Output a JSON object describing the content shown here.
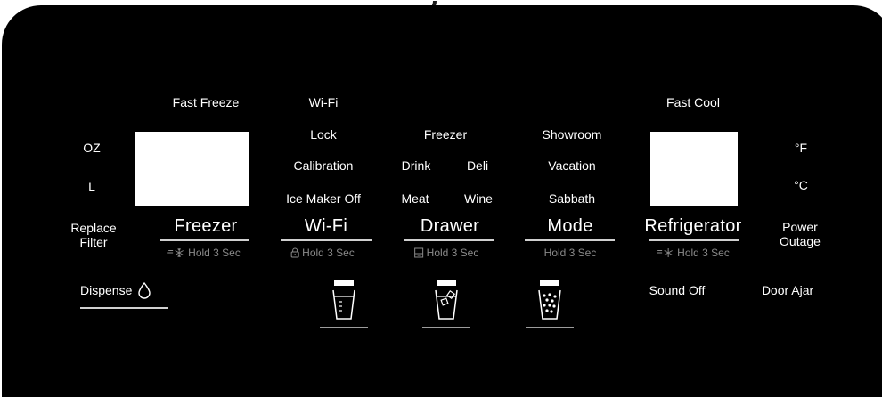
{
  "indicators": {
    "fast_freeze": "Fast Freeze",
    "wifi": "Wi-Fi",
    "lock": "Lock",
    "calibration": "Calibration",
    "ice_maker_off": "Ice Maker Off",
    "freezer": "Freezer",
    "drink": "Drink",
    "deli": "Deli",
    "meat": "Meat",
    "wine": "Wine",
    "showroom": "Showroom",
    "vacation": "Vacation",
    "sabbath": "Sabbath",
    "fast_cool": "Fast Cool",
    "oz": "OZ",
    "l": "L",
    "replace_filter_1": "Replace",
    "replace_filter_2": "Filter",
    "fahrenheit": "°F",
    "celsius": "°C",
    "power_outage_1": "Power",
    "power_outage_2": "Outage",
    "sound_off": "Sound Off",
    "door_ajar": "Door Ajar"
  },
  "buttons": {
    "freezer": {
      "label": "Freezer",
      "hold": "Hold 3 Sec",
      "icon": "fast-freeze-icon"
    },
    "wifi": {
      "label": "Wi-Fi",
      "hold": "Hold 3 Sec",
      "icon": "lock-icon"
    },
    "drawer": {
      "label": "Drawer",
      "hold": "Hold 3 Sec",
      "icon": "drawer-icon"
    },
    "mode": {
      "label": "Mode",
      "hold": "Hold 3 Sec"
    },
    "refrigerator": {
      "label": "Refrigerator",
      "hold": "Hold 3 Sec",
      "icon": "fast-cool-icon"
    },
    "dispense": {
      "label": "Dispense",
      "icon": "water-drop-icon"
    }
  },
  "dispenser_options": [
    "water-cup-icon",
    "cubed-ice-cup-icon",
    "crushed-ice-cup-icon"
  ],
  "colors": {
    "panel": "#000000",
    "text": "#ffffff",
    "hint": "#8a8a8a",
    "screen": "#ffffff"
  }
}
